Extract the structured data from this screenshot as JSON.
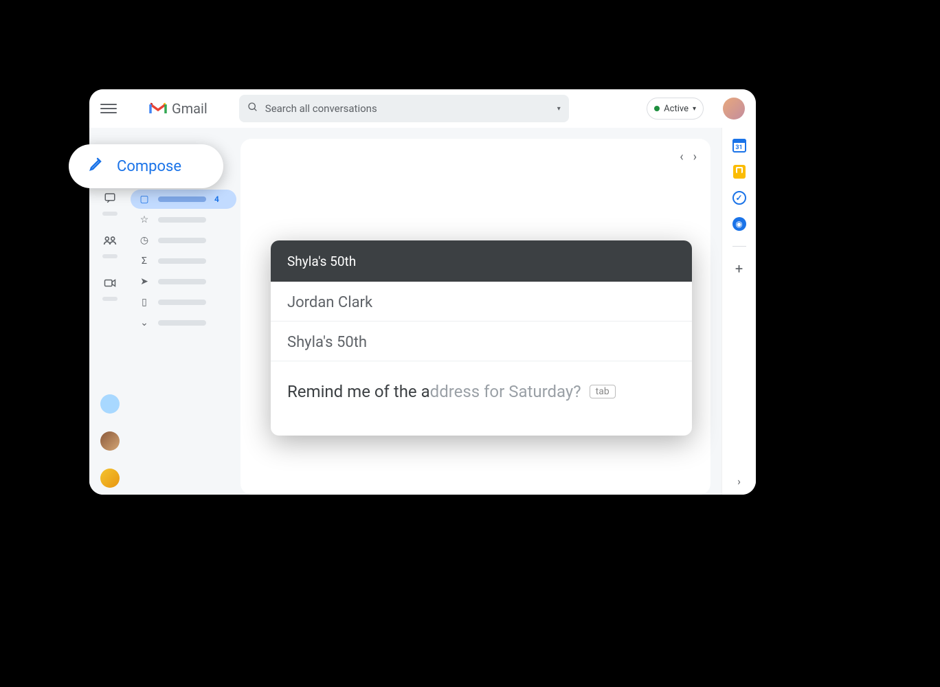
{
  "header": {
    "product": "Gmail",
    "search_placeholder": "Search all conversations",
    "status_label": "Active"
  },
  "compose_button": {
    "label": "Compose"
  },
  "rail": {
    "mail_badge": "4"
  },
  "folders": {
    "inbox_count": "4"
  },
  "sidepanel": {
    "calendar_day": "31"
  },
  "compose": {
    "title": "Shyla's 50th",
    "to": "Jordan Clark",
    "subject": "Shyla's 50th",
    "typed": "Remind me of the a",
    "suggestion": "ddress for Saturday?",
    "tab_hint": "tab"
  }
}
